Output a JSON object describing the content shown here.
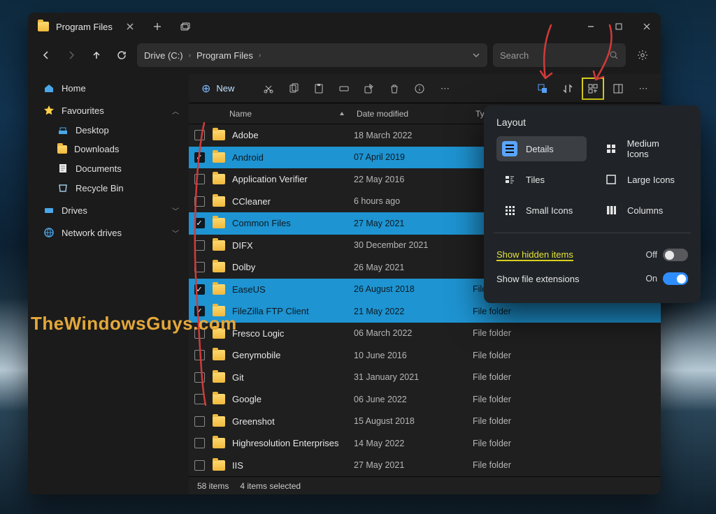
{
  "tab_title": "Program Files",
  "breadcrumb": {
    "seg1": "Drive (C:)",
    "seg2": "Program Files"
  },
  "search_placeholder": "Search",
  "new_button": "New",
  "sidebar": {
    "home": "Home",
    "favourites": "Favourites",
    "children": [
      {
        "label": "Desktop"
      },
      {
        "label": "Downloads"
      },
      {
        "label": "Documents"
      },
      {
        "label": "Recycle Bin"
      }
    ],
    "drives": "Drives",
    "network": "Network drives"
  },
  "columns": {
    "name": "Name",
    "date": "Date modified",
    "type": "Type"
  },
  "rows": [
    {
      "name": "Adobe",
      "date": "18 March 2022",
      "type": "",
      "sel": false
    },
    {
      "name": "Android",
      "date": "07 April 2019",
      "type": "",
      "sel": true
    },
    {
      "name": "Application Verifier",
      "date": "22 May 2016",
      "type": "",
      "sel": false
    },
    {
      "name": "CCleaner",
      "date": "6 hours ago",
      "type": "",
      "sel": false
    },
    {
      "name": "Common Files",
      "date": "27 May 2021",
      "type": "",
      "sel": true
    },
    {
      "name": "DIFX",
      "date": "30 December 2021",
      "type": "",
      "sel": false
    },
    {
      "name": "Dolby",
      "date": "26 May 2021",
      "type": "",
      "sel": false
    },
    {
      "name": "EaseUS",
      "date": "26 August 2018",
      "type": "File folder",
      "sel": true
    },
    {
      "name": "FileZilla FTP Client",
      "date": "21 May 2022",
      "type": "File folder",
      "sel": true
    },
    {
      "name": "Fresco Logic",
      "date": "06 March 2022",
      "type": "File folder",
      "sel": false
    },
    {
      "name": "Genymobile",
      "date": "10 June 2016",
      "type": "File folder",
      "sel": false
    },
    {
      "name": "Git",
      "date": "31 January 2021",
      "type": "File folder",
      "sel": false
    },
    {
      "name": "Google",
      "date": "06 June 2022",
      "type": "File folder",
      "sel": false
    },
    {
      "name": "Greenshot",
      "date": "15 August 2018",
      "type": "File folder",
      "sel": false
    },
    {
      "name": "Highresolution Enterprises",
      "date": "14 May 2022",
      "type": "File folder",
      "sel": false
    },
    {
      "name": "IIS",
      "date": "27 May 2021",
      "type": "File folder",
      "sel": false
    }
  ],
  "status": {
    "count": "58 items",
    "selection": "4 items selected"
  },
  "flyout": {
    "title": "Layout",
    "options": [
      "Details",
      "Medium Icons",
      "Tiles",
      "Large Icons",
      "Small Icons",
      "Columns"
    ],
    "hidden_label": "Show hidden items",
    "hidden_state": "Off",
    "ext_label": "Show file extensions",
    "ext_state": "On"
  },
  "watermark": "TheWindowsGuys.com"
}
